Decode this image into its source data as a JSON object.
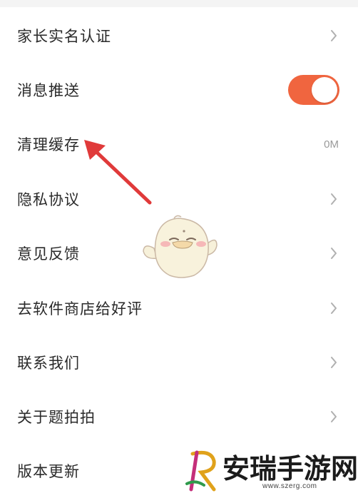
{
  "settings": {
    "items": [
      {
        "label": "家长实名认证",
        "trailing": "chevron"
      },
      {
        "label": "消息推送",
        "trailing": "toggle",
        "toggle_on": true
      },
      {
        "label": "清理缓存",
        "trailing": "value",
        "value": "0M"
      },
      {
        "label": "隐私协议",
        "trailing": "chevron"
      },
      {
        "label": "意见反馈",
        "trailing": "chevron"
      },
      {
        "label": "去软件商店给好评",
        "trailing": "chevron"
      },
      {
        "label": "联系我们",
        "trailing": "chevron"
      },
      {
        "label": "关于题拍拍",
        "trailing": "chevron"
      },
      {
        "label": "版本更新",
        "trailing": "none"
      }
    ]
  },
  "icons": {
    "chevron": "chevron-right-icon",
    "annotation": "red-arrow-icon",
    "mascot": "chick-mascot-icon"
  },
  "colors": {
    "toggle_on": "#f0653f",
    "annotation_arrow": "#e03a3a",
    "text": "#2a2a2a",
    "muted": "#9a9a9a"
  },
  "watermark": {
    "brand": "安瑞手游网",
    "url": "www.szerg.com"
  }
}
